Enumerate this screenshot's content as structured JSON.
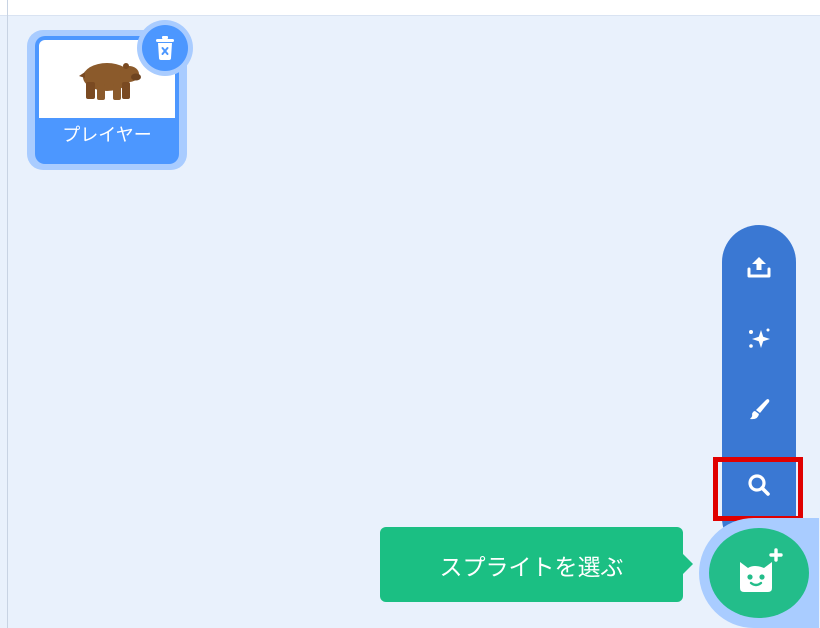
{
  "sprite": {
    "name": "プレイヤー"
  },
  "tooltip": {
    "text": "スプライトを選ぶ"
  },
  "menu": {
    "items": [
      {
        "icon": "upload-icon"
      },
      {
        "icon": "surprise-sparkle-icon"
      },
      {
        "icon": "paint-brush-icon"
      },
      {
        "icon": "search-icon",
        "highlighted": true
      }
    ]
  },
  "colors": {
    "panel_bg": "#e9f1fc",
    "sprite_tile": "#4c97ff",
    "menu_bg": "#3a78d3",
    "fab": "#23bd8a",
    "tooltip_bg": "#1bbf83",
    "highlight": "#e00000"
  }
}
